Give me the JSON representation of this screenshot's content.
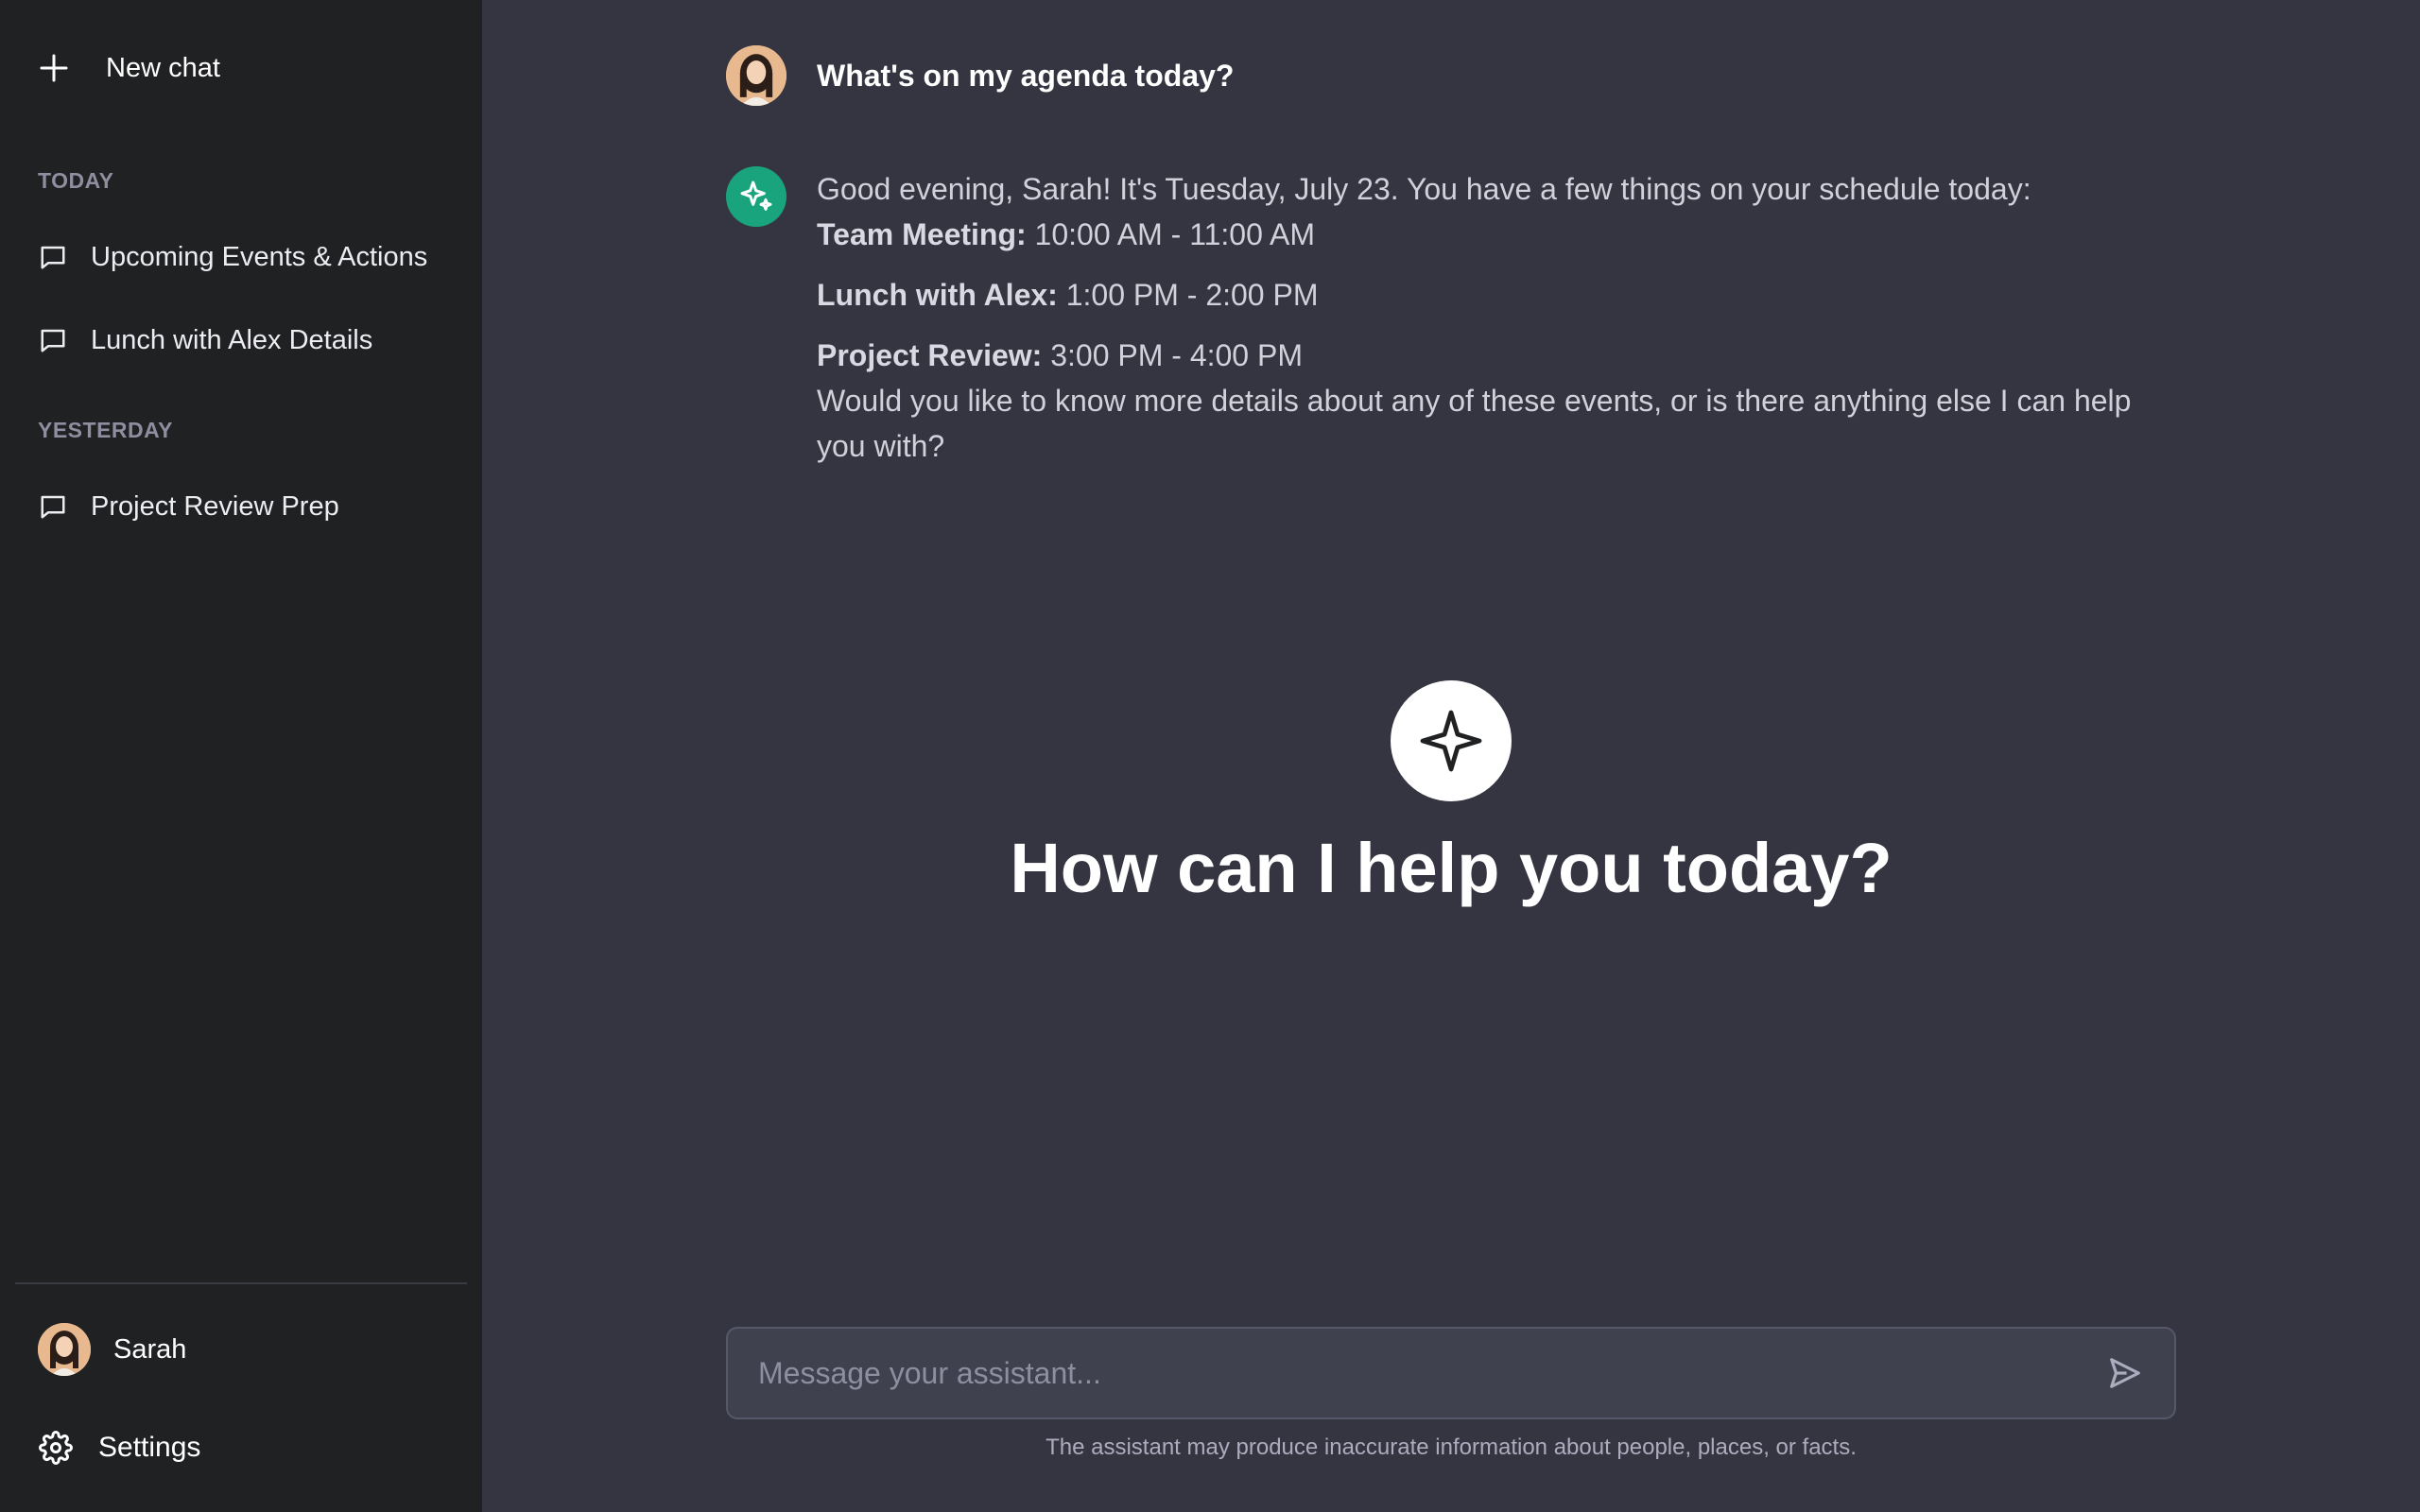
{
  "sidebar": {
    "new_chat_label": "New chat",
    "sections": [
      {
        "label": "TODAY",
        "items": [
          {
            "label": "Upcoming Events & Actions"
          },
          {
            "label": "Lunch with Alex Details"
          }
        ]
      },
      {
        "label": "YESTERDAY",
        "items": [
          {
            "label": "Project Review Prep"
          }
        ]
      }
    ],
    "user": {
      "name": "Sarah"
    },
    "settings_label": "Settings"
  },
  "conversation": {
    "user_message": "What's on my agenda today?",
    "assistant_message": {
      "intro": "Good evening, Sarah! It's Tuesday, July 23. You have a few things on your schedule today:",
      "events": [
        {
          "title": "Team Meeting:",
          "time": " 10:00 AM - 11:00 AM"
        },
        {
          "title": "Lunch with Alex:",
          "time": " 1:00 PM - 2:00 PM"
        },
        {
          "title": "Project Review:",
          "time": " 3:00 PM - 4:00 PM"
        }
      ],
      "outro": "Would you like to know more details about any of these events, or is there anything else I can help you with?"
    }
  },
  "hero": {
    "title": "How can I help you today?",
    "icon": "sparkle-icon"
  },
  "composer": {
    "placeholder": "Message your assistant...",
    "value": "",
    "send_icon": "send-icon"
  },
  "disclaimer": "The assistant may produce inaccurate information about people, places, or facts.",
  "colors": {
    "sidebar_bg": "#202123",
    "main_bg": "#353541",
    "assistant_avatar": "#19a47d",
    "input_bg": "#40414f"
  }
}
